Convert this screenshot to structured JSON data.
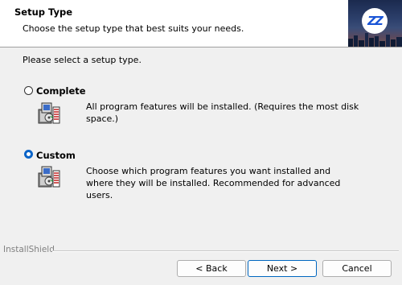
{
  "header": {
    "title": "Setup Type",
    "subtitle": "Choose the setup type that best suits your needs.",
    "logo_text": "ZZ"
  },
  "prompt": "Please select a setup type.",
  "options": [
    {
      "label": "Complete",
      "description": "All program features will be installed. (Requires the most disk space.)",
      "selected": false,
      "icon": "install-package-icon"
    },
    {
      "label": "Custom",
      "description": "Choose which program features you want installed and where they will be installed. Recommended for advanced users.",
      "selected": true,
      "icon": "install-package-icon"
    }
  ],
  "footer": {
    "brand": "InstallShield",
    "back_label": "< Back",
    "next_label": "Next >",
    "cancel_label": "Cancel"
  },
  "colors": {
    "accent": "#0067c0",
    "logo_blue": "#1a55d6"
  }
}
